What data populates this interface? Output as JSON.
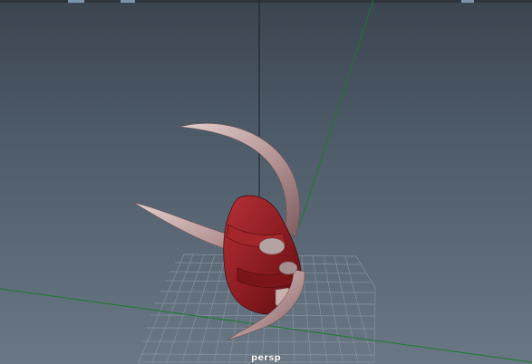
{
  "viewport": {
    "camera_label": "persp",
    "background_top": "#3b4550",
    "background_bottom": "#6a7784"
  },
  "colors": {
    "grid": "#8a96a2",
    "axis_green": "#1c7a2a",
    "axis_black": "#111111",
    "mask_red": "#8b1e22",
    "horn": "#c9b1ae"
  },
  "icons": {
    "model": "oni-mask-icon"
  }
}
